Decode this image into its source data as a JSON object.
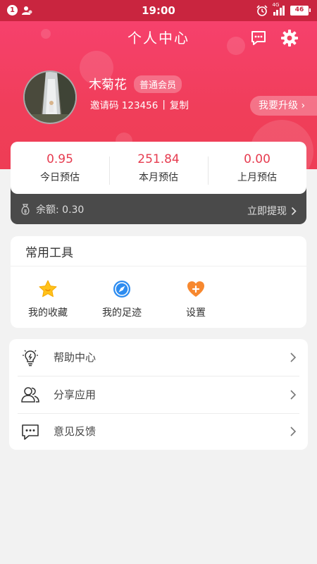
{
  "status_bar": {
    "sim_number": "1",
    "time": "19:00",
    "network": "4G",
    "battery": "46"
  },
  "header": {
    "title": "个人中心"
  },
  "profile": {
    "name": "木菊花",
    "member_level": "普通会员",
    "invite_label": "邀请码 123456",
    "copy_label": "复制",
    "upgrade_label": "我要升级 ›"
  },
  "earnings": {
    "today_value": "0.95",
    "today_label": "今日预估",
    "month_value": "251.84",
    "month_label": "本月预估",
    "last_month_value": "0.00",
    "last_month_label": "上月预估",
    "balance_label": "余额: 0.30",
    "withdraw_label": "立即提现"
  },
  "tools": {
    "title": "常用工具",
    "items": [
      {
        "label": "我的收藏",
        "icon": "star-icon"
      },
      {
        "label": "我的足迹",
        "icon": "compass-icon"
      },
      {
        "label": "设置",
        "icon": "heart-plus-icon"
      }
    ]
  },
  "menu": {
    "items": [
      {
        "label": "帮助中心",
        "icon": "lightbulb-icon"
      },
      {
        "label": "分享应用",
        "icon": "users-icon"
      },
      {
        "label": "意见反馈",
        "icon": "chat-bubble-icon"
      }
    ]
  },
  "colors": {
    "brand_red": "#f0405e",
    "status_bar": "#c9253f",
    "value_red": "#e63c50",
    "dark_panel": "#4a4a4a"
  }
}
